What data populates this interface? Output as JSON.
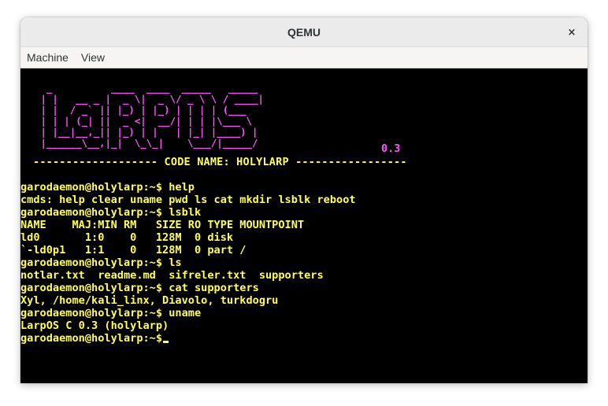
{
  "window": {
    "title": "QEMU",
    "close_glyph": "×"
  },
  "menu": {
    "items": [
      "Machine",
      "View"
    ]
  },
  "screen": {
    "logo_ascii": "  _          ____  ____  _____   _____\n | |   __ _ |  _ \\|  _ \\/ _ \\ \\ / ____|\n | |  / _` || |_) | |_) | | | | (___ \n | | | (_| ||  _ <|  __/| | | |\\___ \\\n | |__|__,_|| |_) | |   | |_| |____) |\n |______\\__,|_|  \\_\\_|    \\___/|_____/",
    "version": "0.3",
    "codename_line": "------------------- CODE NAME: HOLYLARP -----------------",
    "lines": [
      "garodaemon@holylarp:~$ help",
      "cmds: help clear uname pwd ls cat mkdir lsblk reboot",
      "garodaemon@holylarp:~$ lsblk",
      "NAME    MAJ:MIN RM   SIZE RO TYPE MOUNTPOINT",
      "ld0       1:0    0   128M  0 disk",
      "`-ld0p1   1:1    0   128M  0 part /",
      "garodaemon@holylarp:~$ ls",
      "notlar.txt  readme.md  sifreler.txt  supporters",
      "garodaemon@holylarp:~$ cat supporters",
      "Xyl, /home/kali_linx, Diavolo, turkdogru",
      "garodaemon@holylarp:~$ uname",
      "LarpOS C 0.3 (holylarp)",
      "garodaemon@holylarp:~$"
    ]
  },
  "colors": {
    "terminal_text": "#ffff55",
    "logo": "#ff55ff",
    "screen_bg": "#000000"
  }
}
